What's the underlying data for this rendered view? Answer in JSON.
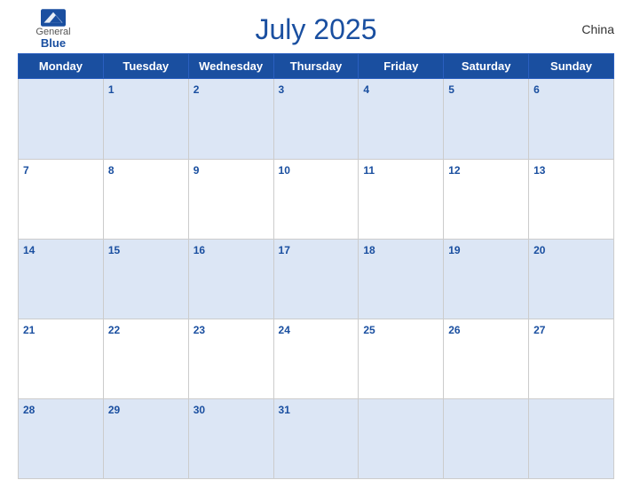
{
  "header": {
    "logo": {
      "general": "General",
      "blue": "Blue",
      "icon_title": "GeneralBlue logo"
    },
    "title": "July 2025",
    "country": "China"
  },
  "weekdays": [
    "Monday",
    "Tuesday",
    "Wednesday",
    "Thursday",
    "Friday",
    "Saturday",
    "Sunday"
  ],
  "weeks": [
    [
      null,
      1,
      2,
      3,
      4,
      5,
      6
    ],
    [
      7,
      8,
      9,
      10,
      11,
      12,
      13
    ],
    [
      14,
      15,
      16,
      17,
      18,
      19,
      20
    ],
    [
      21,
      22,
      23,
      24,
      25,
      26,
      27
    ],
    [
      28,
      29,
      30,
      31,
      null,
      null,
      null
    ]
  ]
}
